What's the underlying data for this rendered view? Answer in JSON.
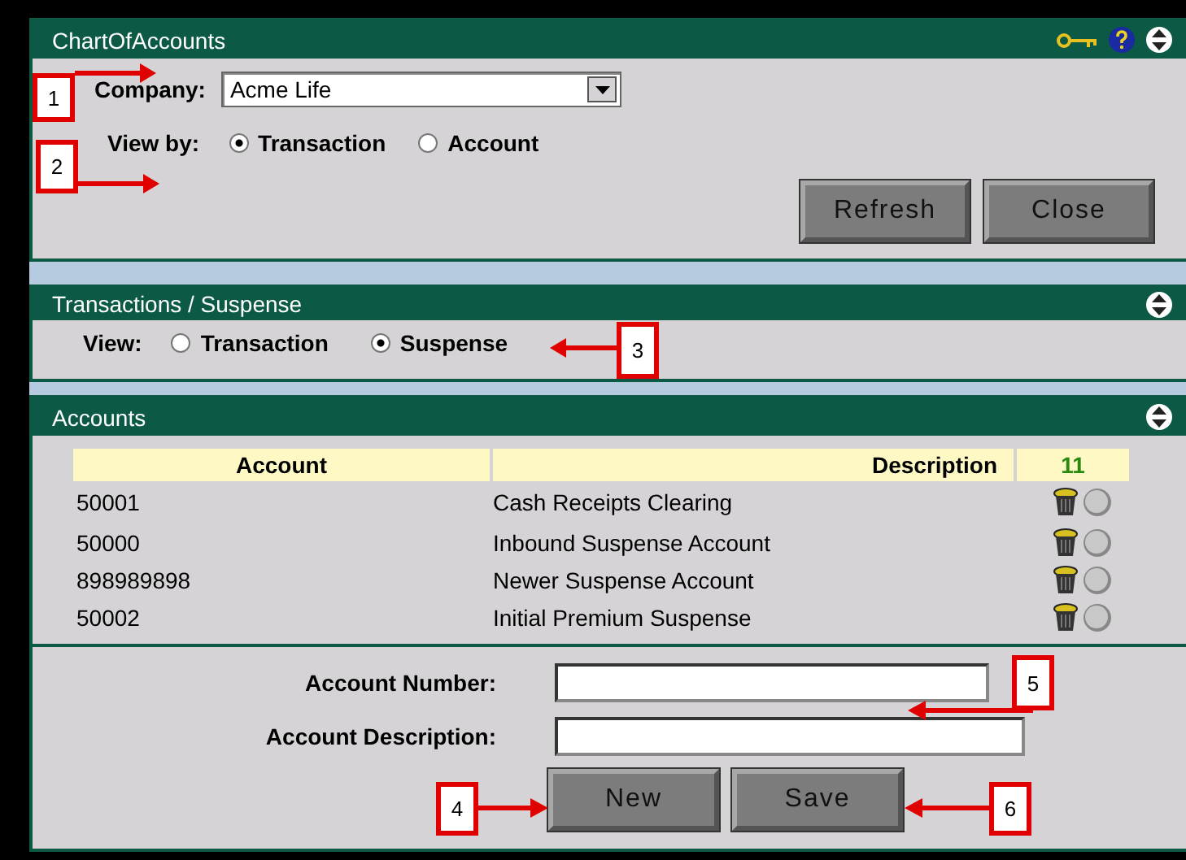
{
  "main_panel": {
    "title": "ChartOfAccounts",
    "company_label": "Company:",
    "company": "Acme Life",
    "view_by_label": "View by:",
    "view_by_options": [
      {
        "label": "Transaction",
        "selected": true
      },
      {
        "label": "Account",
        "selected": false
      }
    ],
    "buttons": [
      "Refresh",
      "Close"
    ]
  },
  "transactions_panel": {
    "title": "Transactions / Suspense",
    "view_label": "View:",
    "view_options": [
      {
        "label": "Transaction",
        "selected": false
      },
      {
        "label": "Suspense",
        "selected": true
      }
    ]
  },
  "accounts_panel": {
    "title": "Accounts",
    "table": {
      "columns": [
        "Account",
        "Description",
        "11"
      ],
      "rows": [
        {
          "account": "50001",
          "description": "Cash Receipts Clearing"
        },
        {
          "account": "50000",
          "description": "Inbound Suspense Account"
        },
        {
          "account": "898989898",
          "description": "Newer Suspense Account"
        },
        {
          "account": "50002",
          "description": "Initial Premium Suspense"
        }
      ]
    },
    "form": {
      "account_number_label": "Account Number:",
      "account_description_label": "Account Description:",
      "buttons": [
        "New",
        "Save"
      ]
    }
  },
  "callouts": [
    {
      "label": "1"
    },
    {
      "label": "2"
    },
    {
      "label": "3"
    },
    {
      "label": "4"
    },
    {
      "label": "5"
    },
    {
      "label": "6"
    }
  ]
}
